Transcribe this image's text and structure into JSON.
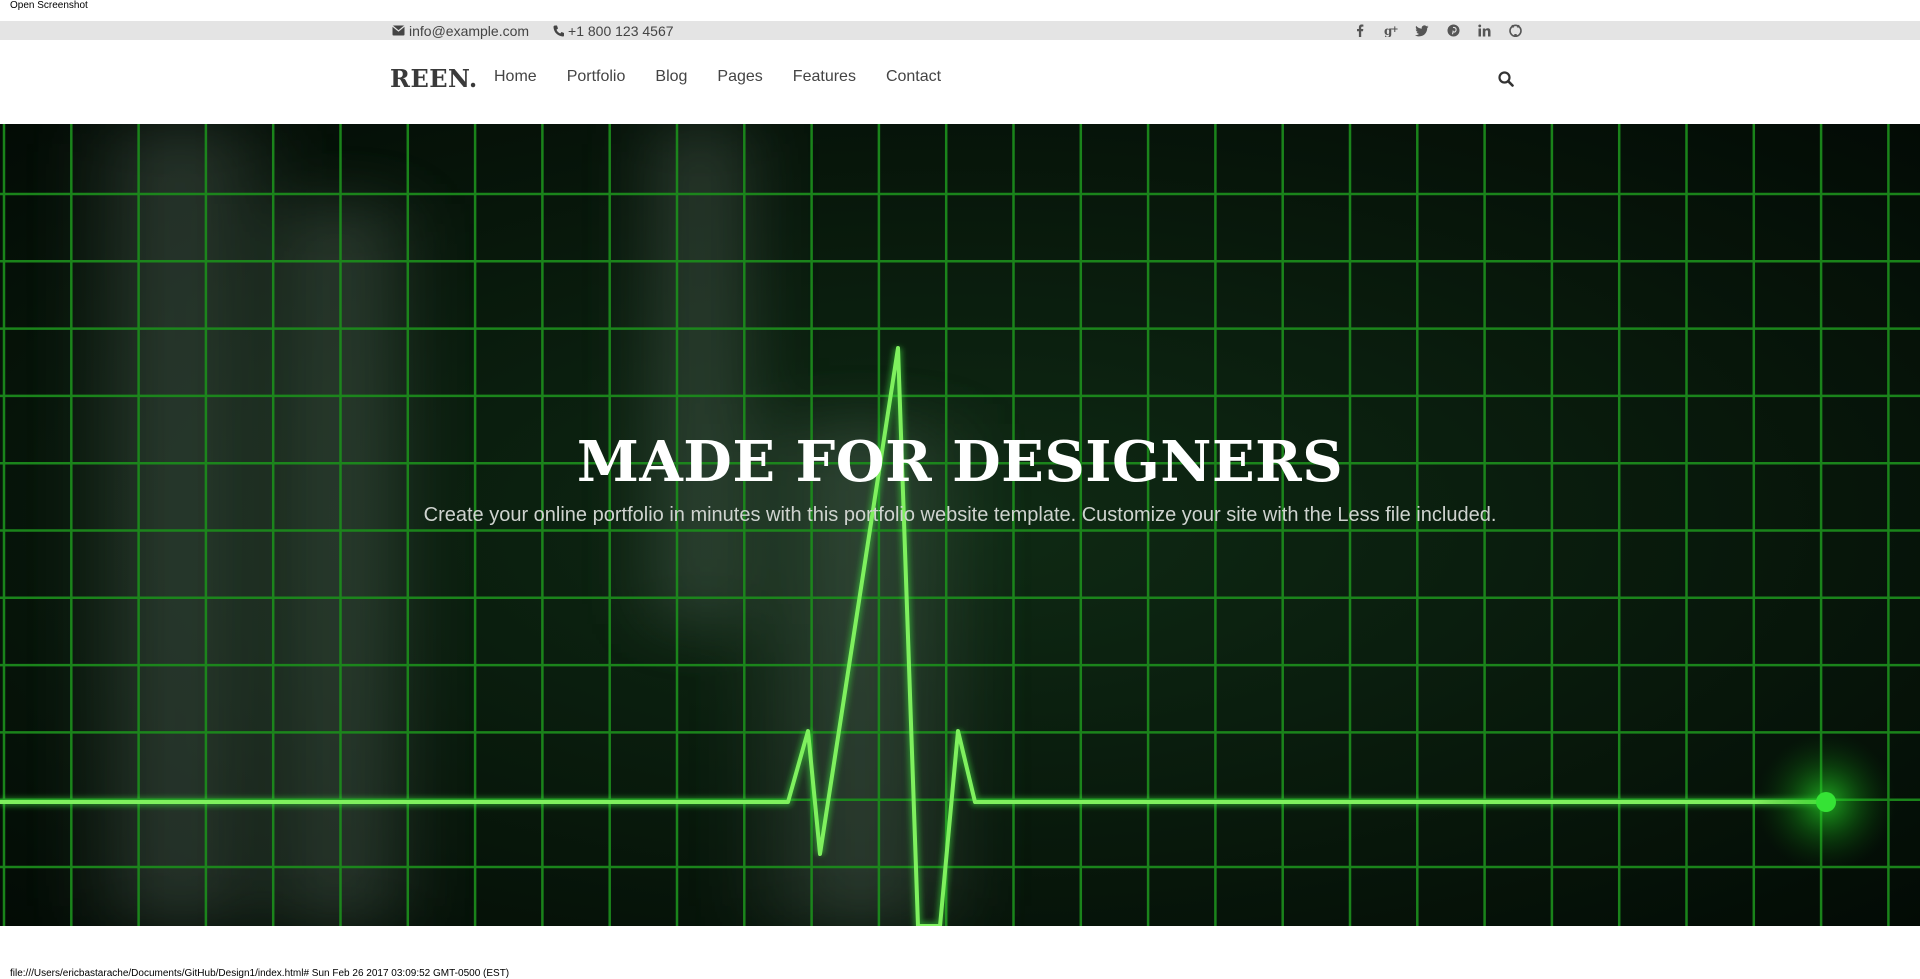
{
  "print": {
    "header": "Open Screenshot",
    "footer": "file:///Users/ericbastarache/Documents/GitHub/Design1/index.html# Sun Feb 26 2017 03:09:52 GMT-0500 (EST)"
  },
  "topbar": {
    "email": "info@example.com",
    "phone": "+1 800 123 4567",
    "email_icon": "envelope-icon",
    "phone_icon": "phone-icon",
    "social": [
      {
        "name": "facebook-icon",
        "glyph": "f"
      },
      {
        "name": "google-plus-icon",
        "glyph": "g+"
      },
      {
        "name": "twitter-icon",
        "glyph": "t"
      },
      {
        "name": "pinterest-icon",
        "glyph": "p"
      },
      {
        "name": "linkedin-icon",
        "glyph": "in"
      },
      {
        "name": "github-icon",
        "glyph": "gh"
      }
    ]
  },
  "nav": {
    "logo": "REEN.",
    "items": [
      "Home",
      "Portfolio",
      "Blog",
      "Pages",
      "Features",
      "Contact"
    ],
    "search_icon": "search-icon"
  },
  "hero": {
    "title": "MADE FOR DESIGNERS",
    "subtitle": "Create your online portfolio in minutes with this portfolio website template. Customize your site with the Less file included."
  },
  "colors": {
    "grid": "#1c8a1c",
    "trace": "#5ee64a",
    "background": "#061209"
  }
}
